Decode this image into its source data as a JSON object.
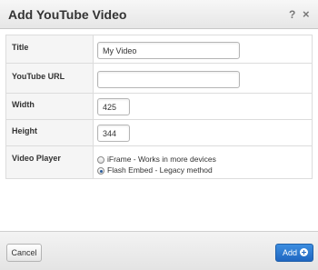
{
  "dialog": {
    "title": "Add YouTube Video",
    "help_label": "?",
    "close_label": "×"
  },
  "fields": {
    "title": {
      "label": "Title",
      "value": "My Video"
    },
    "youtube_url": {
      "label": "YouTube URL",
      "value": ""
    },
    "width": {
      "label": "Width",
      "value": "425"
    },
    "height": {
      "label": "Height",
      "value": "344"
    },
    "video_player": {
      "label": "Video Player",
      "options": [
        {
          "label": "iFrame - Works in more devices",
          "selected": false
        },
        {
          "label": "Flash Embed - Legacy method",
          "selected": true
        }
      ]
    }
  },
  "footer": {
    "cancel_label": "Cancel",
    "add_label": "Add"
  },
  "colors": {
    "primary_button": "#2a74cc"
  }
}
